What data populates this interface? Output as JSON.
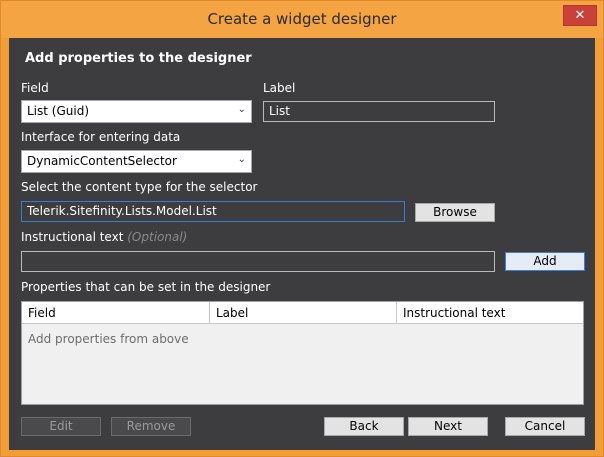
{
  "window": {
    "title": "Create a widget designer",
    "close_glyph": "✕"
  },
  "form": {
    "heading": "Add properties to the designer",
    "field_label": "Field",
    "field_value": "List (Guid)",
    "label_label": "Label",
    "label_value": "List",
    "interface_label": "Interface for entering data",
    "interface_value": "DynamicContentSelector",
    "content_type_label": "Select the content type for the selector",
    "content_type_value": "Telerik.Sitefinity.Lists.Model.List",
    "browse_button": "Browse",
    "instructional_label": "Instructional text",
    "instructional_optional": "(Optional)",
    "instructional_value": "",
    "add_button": "Add",
    "properties_label": "Properties that can be set in the designer"
  },
  "grid": {
    "columns": [
      "Field",
      "Label",
      "Instructional text"
    ],
    "empty_text": "Add properties from above"
  },
  "footer": {
    "edit": "Edit",
    "remove": "Remove",
    "back": "Back",
    "next": "Next",
    "cancel": "Cancel"
  },
  "colors": {
    "accent": "#f29d38",
    "client_bg": "#3d3d3f",
    "close_button": "#c9423a"
  },
  "icons": {
    "dropdown": "chevron-down-icon",
    "close": "close-icon"
  }
}
